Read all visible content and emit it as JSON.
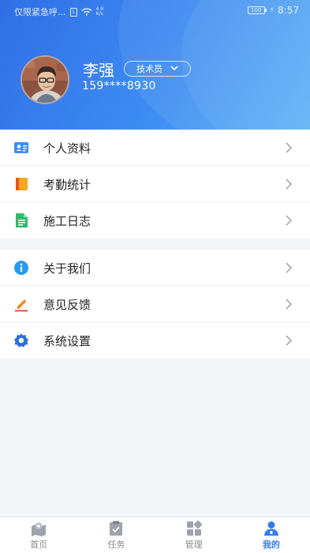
{
  "status_bar": {
    "carrier": "仅限紧急呼...",
    "sim": "1",
    "net_speed_value": "4.9",
    "net_speed_unit": "K/s",
    "battery": "100",
    "time": "8:57"
  },
  "profile": {
    "name": "李强",
    "role": "技术员",
    "phone": "159****8930"
  },
  "menu_group_1": [
    {
      "label": "个人资料",
      "icon": "id-card-icon"
    },
    {
      "label": "考勤统计",
      "icon": "notebook-icon"
    },
    {
      "label": "施工日志",
      "icon": "document-icon"
    }
  ],
  "menu_group_2": [
    {
      "label": "关于我们",
      "icon": "info-icon"
    },
    {
      "label": "意见反馈",
      "icon": "pencil-icon"
    },
    {
      "label": "系统设置",
      "icon": "gear-icon"
    }
  ],
  "tabs": [
    {
      "label": "首页",
      "icon": "map-pin-icon"
    },
    {
      "label": "任务",
      "icon": "task-icon"
    },
    {
      "label": "管理",
      "icon": "grid-icon"
    },
    {
      "label": "我的",
      "icon": "user-icon"
    }
  ],
  "colors": {
    "accent": "#2f7cf6",
    "header_start": "#2f6fe6",
    "header_end": "#58b0f7"
  }
}
